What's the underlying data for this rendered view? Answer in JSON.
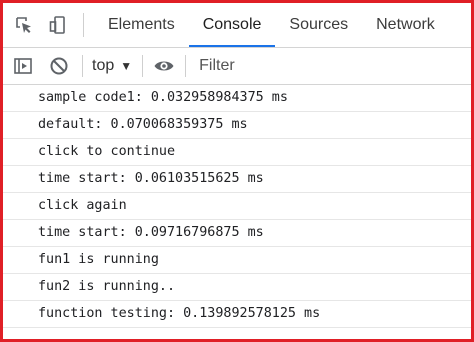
{
  "tabs": [
    {
      "label": "Elements",
      "active": false
    },
    {
      "label": "Console",
      "active": true
    },
    {
      "label": "Sources",
      "active": false
    },
    {
      "label": "Network",
      "active": false
    }
  ],
  "toolbar": {
    "context": "top",
    "filter_placeholder": "Filter"
  },
  "console": {
    "messages": [
      "sample code1: 0.032958984375 ms",
      "default: 0.070068359375 ms",
      "click to continue",
      "time start: 0.06103515625 ms",
      "click again",
      "time start: 0.09716796875 ms",
      "fun1 is running",
      "fun2 is running..",
      "function testing: 0.139892578125 ms"
    ]
  },
  "colors": {
    "frame_border": "#e01f26",
    "active_tab_underline": "#1a73e8",
    "icon": "#5f6368"
  },
  "icons": {
    "inspect": "inspect-element-icon",
    "device": "device-toolbar-icon",
    "sidebar": "show-sidebar-icon",
    "clear": "clear-console-icon",
    "dropdown": "chevron-down-icon",
    "eye": "live-expression-icon"
  }
}
